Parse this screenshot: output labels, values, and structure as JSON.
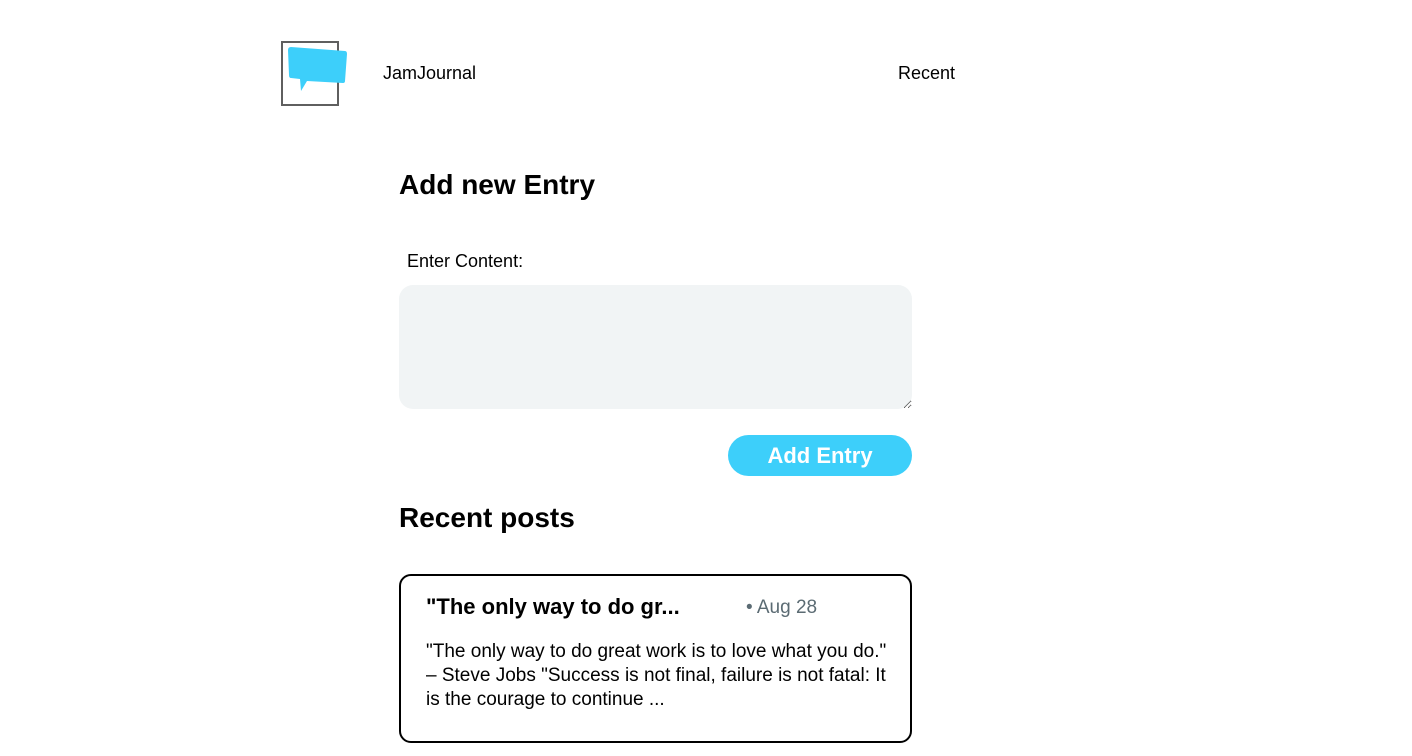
{
  "header": {
    "brand": "JamJournal",
    "nav_recent": "Recent",
    "logo_icon": "chat-bubble-icon",
    "accent_color": "#3dcffa"
  },
  "form": {
    "title": "Add new Entry",
    "content_label": "Enter Content:",
    "content_value": "",
    "submit_label": "Add Entry"
  },
  "recent": {
    "title": "Recent posts",
    "posts": [
      {
        "title": "\"The only way to do gr...",
        "date": "• Aug 28",
        "excerpt": "\"The only way to do great work is to love what you do.\" – Steve Jobs \"Success is not final, failure is not fatal: It is the courage to continue ..."
      }
    ]
  }
}
